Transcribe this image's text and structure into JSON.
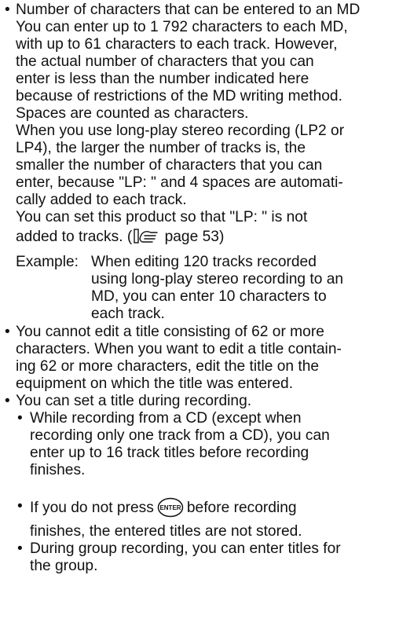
{
  "bullet": "•",
  "sections": {
    "characters": {
      "lines": [
        "Number of characters that can be entered to an MD",
        "You can enter up to 1 792 characters to each MD,",
        "with up to 61 characters to each track. However,",
        "the actual number of characters that you can",
        "enter is less than the number indicated here",
        "because of restrictions of the MD writing method.",
        "Spaces are counted as characters.",
        "When you use long-play stereo recording (LP2 or",
        "LP4), the larger the number of tracks is, the",
        "smaller the number of characters that you can",
        "enter, because \"LP: \" and 4 spaces are automati-",
        "cally added to each track.",
        "You can set this product so that \"LP: \" is not"
      ],
      "ref_before": "added to tracks. (",
      "ref_after": " page 53)",
      "example_label": "Example:",
      "example_lines": [
        "When editing 120 tracks recorded",
        "using long-play stereo recording to an",
        "MD, you can enter 10 characters to",
        "each track."
      ]
    },
    "edit_limit": {
      "lines": [
        "You cannot edit a title consisting of 62 or more",
        "characters. When you want to edit a title contain-",
        "ing 62 or more characters, edit the title on the",
        "equipment on which the title was entered."
      ]
    },
    "during_recording": {
      "line": "You can set a title during recording.",
      "sub1_lines": [
        "While recording from a CD (except when",
        "recording only one track from a CD), you can",
        "enter up to 16 track titles before recording",
        "finishes."
      ],
      "sub2_before": "If you do not press",
      "sub2_after": "before recording",
      "sub2_line2": "finishes, the entered titles are not stored.",
      "enter_button_label": "ENTER",
      "sub3_lines": [
        "During group recording, you can enter titles for",
        "the group."
      ]
    }
  }
}
